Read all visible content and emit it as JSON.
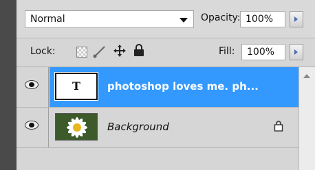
{
  "blend_mode": {
    "value": "Normal"
  },
  "opacity": {
    "label": "Opacity:",
    "value": "100%"
  },
  "lock": {
    "label": "Lock:",
    "icons": [
      "lock-transparency-icon",
      "lock-paint-icon",
      "lock-position-icon",
      "lock-all-icon"
    ]
  },
  "fill": {
    "label": "Fill:",
    "value": "100%"
  },
  "layers": [
    {
      "name": "photoshop loves me. ph...",
      "thumb_letter": "T",
      "selected": true
    },
    {
      "name": "Background",
      "locked": true
    }
  ],
  "colors": {
    "selection": "#3399ff",
    "panel": "#d6d6d6"
  }
}
